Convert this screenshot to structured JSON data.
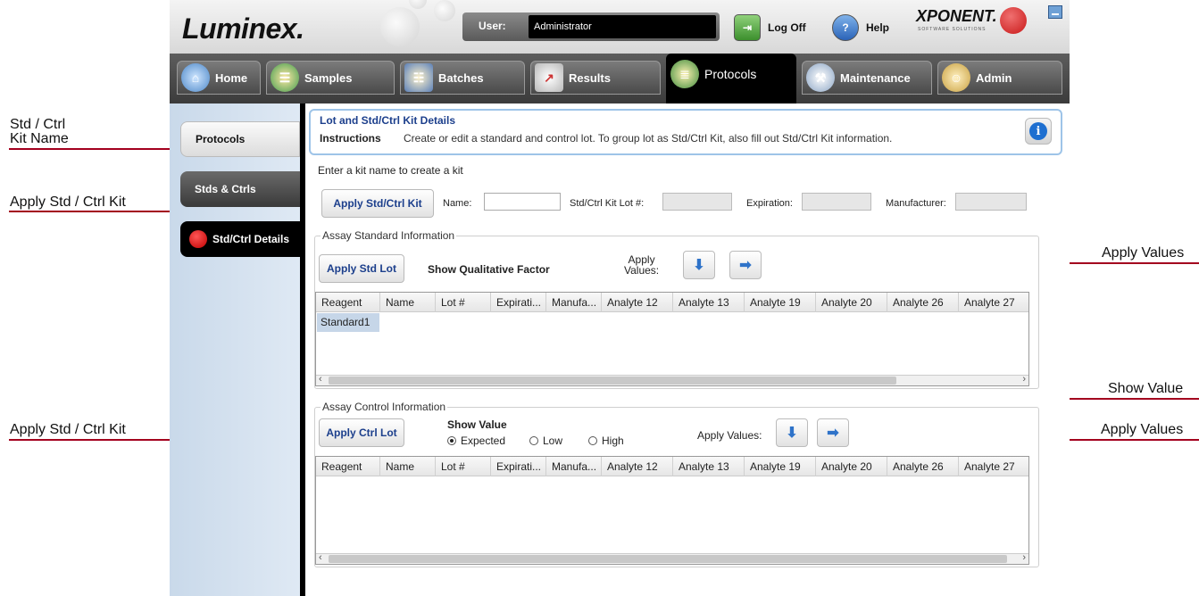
{
  "annotations": {
    "kit_name_line1": "Std / Ctrl",
    "kit_name_line2": "Kit Name",
    "apply_kit_top": "Apply Std / Ctrl Kit",
    "apply_kit_bottom": "Apply Std / Ctrl Kit",
    "apply_values_top": "Apply Values",
    "show_value": "Show Value",
    "apply_values_bottom": "Apply Values"
  },
  "header": {
    "logo": "Luminex.",
    "user_label": "User:",
    "user_value": "Administrator",
    "logoff_label": "Log Off",
    "help_label": "Help",
    "brand": "XPONENT.",
    "brand_sub": "SOFTWARE SOLUTIONS"
  },
  "tabs": [
    {
      "label": "Home",
      "icon": "home-icon"
    },
    {
      "label": "Samples",
      "icon": "samples-icon"
    },
    {
      "label": "Batches",
      "icon": "batches-icon"
    },
    {
      "label": "Results",
      "icon": "results-icon"
    },
    {
      "label": "Protocols",
      "icon": "protocols-icon",
      "active": true
    },
    {
      "label": "Maintenance",
      "icon": "maintenance-icon"
    },
    {
      "label": "Admin",
      "icon": "admin-icon"
    }
  ],
  "sidebar": {
    "items": [
      {
        "label": "Protocols"
      },
      {
        "label": "Stds & Ctrls"
      },
      {
        "label": "Std/Ctrl Details"
      }
    ]
  },
  "info": {
    "title": "Lot and Std/Ctrl Kit Details",
    "instructions_label": "Instructions",
    "instructions_text": "Create or edit a standard and control lot.  To group lot as Std/Ctrl Kit, also fill out Std/Ctrl Kit information."
  },
  "kit": {
    "prompt": "Enter a kit name to create a kit",
    "apply_button": "Apply Std/Ctrl Kit",
    "name_label": "Name:",
    "name_value": "",
    "lot_label": "Std/Ctrl Kit Lot #:",
    "lot_value": "",
    "expiration_label": "Expiration:",
    "expiration_value": "",
    "manufacturer_label": "Manufacturer:",
    "manufacturer_value": ""
  },
  "standard": {
    "group_title": "Assay Standard Information",
    "apply_button": "Apply Std Lot",
    "qualitative_label": "Show Qualitative Factor",
    "apply_values_line1": "Apply",
    "apply_values_line2": "Values:",
    "columns": [
      "Reagent",
      "Name",
      "Lot #",
      "Expirati...",
      "Manufa...",
      "Analyte 12",
      "Analyte 13",
      "Analyte 19",
      "Analyte 20",
      "Analyte 26",
      "Analyte 27"
    ],
    "rows": [
      [
        "Standard1"
      ]
    ]
  },
  "control": {
    "group_title": "Assay Control Information",
    "apply_button": "Apply Ctrl Lot",
    "show_value_label": "Show Value",
    "radio_options": [
      "Expected",
      "Low",
      "High"
    ],
    "selected": "Expected",
    "apply_values_label": "Apply Values:",
    "columns": [
      "Reagent",
      "Name",
      "Lot #",
      "Expirati...",
      "Manufa...",
      "Analyte 12",
      "Analyte 13",
      "Analyte 19",
      "Analyte 20",
      "Analyte 26",
      "Analyte 27"
    ]
  },
  "colors": {
    "annotation_red": "#a3001e",
    "accent_blue": "#1c3f8c",
    "active_tab": "#000000"
  }
}
